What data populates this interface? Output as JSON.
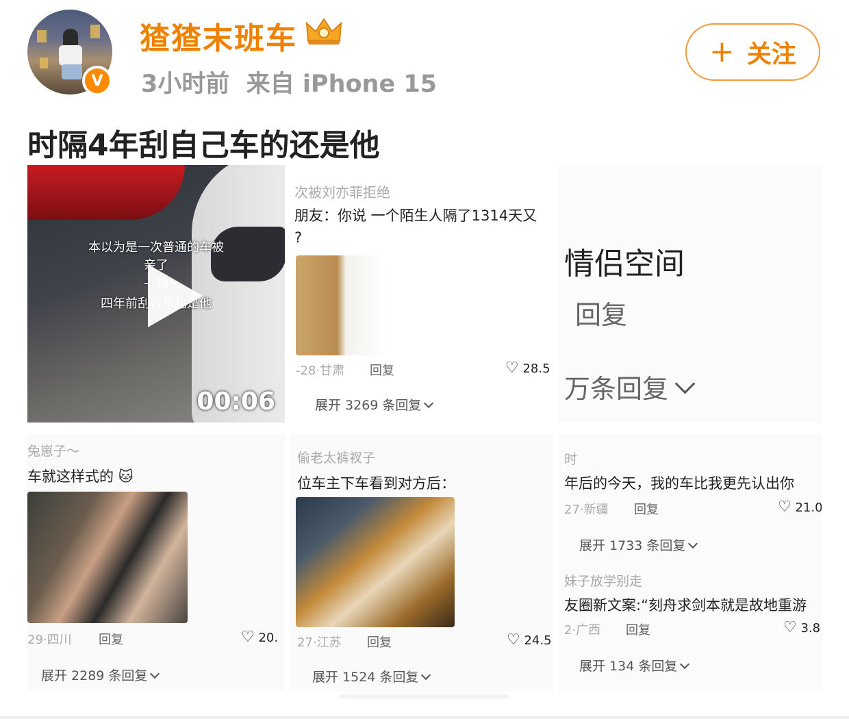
{
  "header": {
    "username": "猹猹末班车",
    "time": "3小时前",
    "source": "来自 iPhone 15",
    "follow_label": "关注",
    "follow_icon": "plus-icon",
    "badge_icon": "crown-icon",
    "verified_icon": "verified-v-icon",
    "verified_letter": "V"
  },
  "post": {
    "text": "时隔4年刮自己车的还是他"
  },
  "video": {
    "caption_lines": [
      "本以为是一次普通的车被",
      "亲了",
      "一聊",
      "四年前刮我车也是他"
    ],
    "duration": "00:06"
  },
  "tile1": {
    "title": "次被刘亦菲拒绝",
    "line1": "朋友：你说 一个陌生人隔了1314天又",
    "line2": "?",
    "meta_date": "-28·甘肃",
    "reply": "回复",
    "likes": "28.5",
    "expand": "展开 3269 条回复"
  },
  "tile2": {
    "title": "情侣空间",
    "reply": "回复",
    "expand": "万条回复"
  },
  "tile3": {
    "user": "兔崽子～",
    "text": "车就这样式的",
    "meta_date": "29·四川",
    "reply": "回复",
    "likes": "20.",
    "expand": "展开 2289 条回复"
  },
  "tile4": {
    "user": "偷老太裤衩子",
    "text": "位车主下车看到对方后：",
    "meta_date": "27·江苏",
    "reply": "回复",
    "likes": "24.5",
    "expand": "展开 1524 条回复"
  },
  "tile5": {
    "user1": "时",
    "text1": "年后的今天，我的车比我更先认出你",
    "meta1_date": "27·新疆",
    "reply1": "回复",
    "likes1": "21.0",
    "expand1": "展开 1733 条回复",
    "user2": "妹子放学别走",
    "text2": "友圈新文案:“刻舟求剑本就是故地重游",
    "meta2_date": "2·广西",
    "reply2": "回复",
    "likes2": "3.8",
    "expand2": "展开 134 条回复"
  },
  "colors": {
    "accent": "#f08000",
    "follow_border": "#f39a3d",
    "verified": "#ff8a00"
  }
}
